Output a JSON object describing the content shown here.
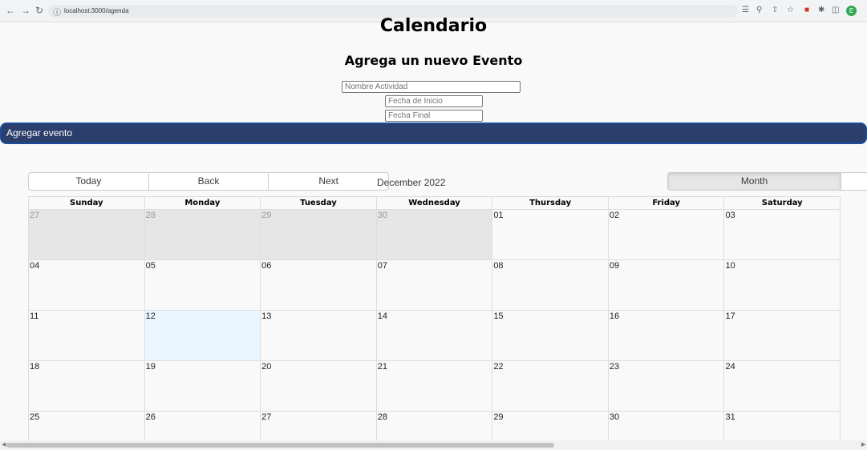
{
  "browser": {
    "url": "localhost:3000/agenda"
  },
  "page": {
    "title": "Calendario",
    "form_title": "Agrega un nuevo Evento",
    "fields": {
      "name_placeholder": "Nombre Actividad",
      "start_placeholder": "Fecha de Inicio",
      "end_placeholder": "Fecha Final"
    },
    "add_button": "Agregar evento"
  },
  "calendar": {
    "toolbar": {
      "today": "Today",
      "back": "Back",
      "next": "Next",
      "label": "December 2022",
      "views": [
        "Month"
      ]
    },
    "weekdays": [
      "Sunday",
      "Monday",
      "Tuesday",
      "Wednesday",
      "Thursday",
      "Friday",
      "Saturday"
    ],
    "weeks": [
      [
        {
          "d": "27",
          "off": true
        },
        {
          "d": "28",
          "off": true
        },
        {
          "d": "29",
          "off": true
        },
        {
          "d": "30",
          "off": true
        },
        {
          "d": "01"
        },
        {
          "d": "02"
        },
        {
          "d": "03"
        }
      ],
      [
        {
          "d": "04"
        },
        {
          "d": "05"
        },
        {
          "d": "06"
        },
        {
          "d": "07"
        },
        {
          "d": "08"
        },
        {
          "d": "09"
        },
        {
          "d": "10"
        }
      ],
      [
        {
          "d": "11"
        },
        {
          "d": "12",
          "today": true
        },
        {
          "d": "13"
        },
        {
          "d": "14"
        },
        {
          "d": "15"
        },
        {
          "d": "16"
        },
        {
          "d": "17"
        }
      ],
      [
        {
          "d": "18"
        },
        {
          "d": "19"
        },
        {
          "d": "20"
        },
        {
          "d": "21"
        },
        {
          "d": "22"
        },
        {
          "d": "23"
        },
        {
          "d": "24"
        }
      ],
      [
        {
          "d": "25"
        },
        {
          "d": "26"
        },
        {
          "d": "27"
        },
        {
          "d": "28"
        },
        {
          "d": "29"
        },
        {
          "d": "30"
        },
        {
          "d": "31"
        }
      ]
    ]
  },
  "colors": {
    "button_bg": "#2c3e6b",
    "button_border": "#1a4d9c",
    "offrange_bg": "#e6e6e6",
    "today_bg": "#eaf6ff"
  }
}
